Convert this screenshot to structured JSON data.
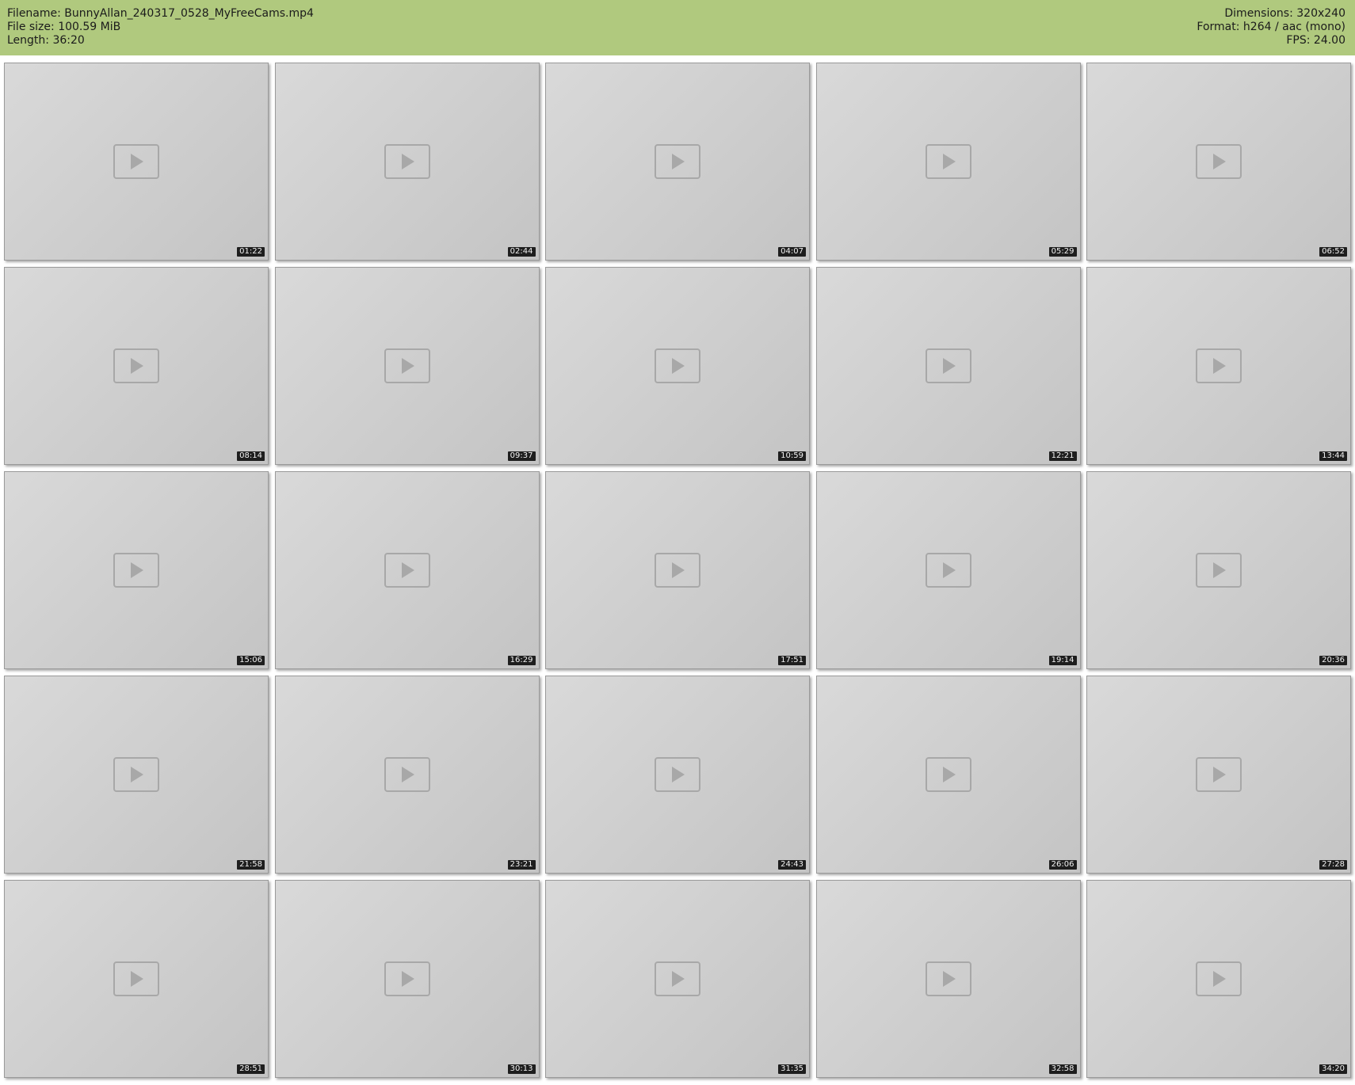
{
  "header": {
    "left": [
      "Filename: BunnyAllan_240317_0528_MyFreeCams.mp4",
      "File size: 100.59 MiB",
      "Length: 36:20"
    ],
    "right": [
      "Dimensions: 320x240",
      "Format: h264 / aac (mono)",
      "FPS: 24.00"
    ]
  },
  "thumbnails": [
    "01:22",
    "02:44",
    "04:07",
    "05:29",
    "06:52",
    "08:14",
    "09:37",
    "10:59",
    "12:21",
    "13:44",
    "15:06",
    "16:29",
    "17:51",
    "19:14",
    "20:36",
    "21:58",
    "23:21",
    "24:43",
    "26:06",
    "27:28",
    "28:51",
    "30:13",
    "31:35",
    "32:58",
    "34:20"
  ],
  "colors": {
    "header_bg": "#b0c97e",
    "timestamp_bg": "#1e1e1e"
  }
}
